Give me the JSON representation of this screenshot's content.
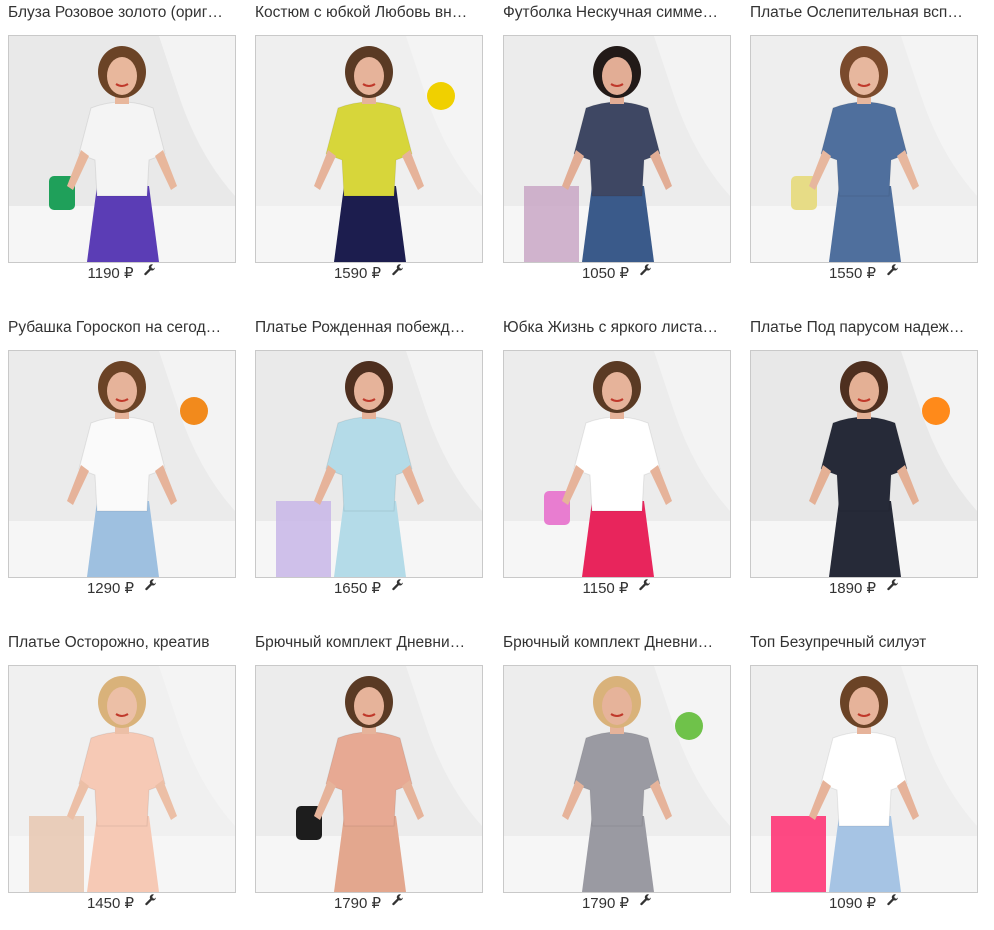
{
  "products": [
    {
      "title": "Блуза Розовое золото (ориг…",
      "price": "1190 ₽",
      "icon": "wrench-icon",
      "bg": "#e9e9e9",
      "top": "#f4f4f4",
      "bottom": "#5b3db5",
      "acc": "#1fa05a",
      "skin": "#e8b79c",
      "hair": "#6b4326"
    },
    {
      "title": "Костюм с юбкой Любовь вн…",
      "price": "1590 ₽",
      "icon": "wrench-icon",
      "bg": "#efefef",
      "top": "#d7d63a",
      "bottom": "#1c1d4e",
      "acc": "#f0d000",
      "skin": "#e6b39a",
      "hair": "#5a3a24"
    },
    {
      "title": "Футболка Нескучная симме…",
      "price": "1050 ₽",
      "icon": "wrench-icon",
      "bg": "#ececec",
      "top": "#3e4763",
      "bottom": "#3a5a8a",
      "acc": "#c9a7c5",
      "skin": "#e2ad95",
      "hair": "#221a18"
    },
    {
      "title": "Платье Ослепительная всп…",
      "price": "1550 ₽",
      "icon": "wrench-icon",
      "bg": "#eeeeee",
      "top": "#4f6f9d",
      "bottom": "#4f6f9d",
      "acc": "#e7dc86",
      "skin": "#e7b79e",
      "hair": "#7a4a2c"
    },
    {
      "title": "Рубашка Гороскоп на сегод…",
      "price": "1290 ₽",
      "icon": "wrench-icon",
      "bg": "#ebebeb",
      "top": "#fafafa",
      "bottom": "#9ec0e0",
      "acc": "#f28a1c",
      "skin": "#e6b39a",
      "hair": "#6b4326"
    },
    {
      "title": "Платье Рожденная побежд…",
      "price": "1650 ₽",
      "icon": "wrench-icon",
      "bg": "#eaeaea",
      "top": "#b4dbe8",
      "bottom": "#b4dbe8",
      "acc": "#c8b6e8",
      "skin": "#e6b39a",
      "hair": "#4e2f1f"
    },
    {
      "title": "Юбка Жизнь с яркого листа…",
      "price": "1150 ₽",
      "icon": "wrench-icon",
      "bg": "#ececec",
      "top": "#ffffff",
      "bottom": "#e8255c",
      "acc": "#e87dd0",
      "skin": "#e6b39a",
      "hair": "#5a3a24"
    },
    {
      "title": "Платье Под парусом надеж…",
      "price": "1890 ₽",
      "icon": "wrench-icon",
      "bg": "#e8e8e8",
      "top": "#262a38",
      "bottom": "#262a38",
      "acc": "#ff8a1a",
      "skin": "#e4b095",
      "hair": "#4e2f1f"
    },
    {
      "title": "Платье Осторожно, креатив",
      "price": "1450 ₽",
      "icon": "wrench-icon",
      "bg": "#f0f0f0",
      "top": "#f6c9b5",
      "bottom": "#f6c9b5",
      "acc": "#e7c7b0",
      "skin": "#ecbfa6",
      "hair": "#d9b27a"
    },
    {
      "title": "Брючный комплект Дневни…",
      "price": "1790 ₽",
      "icon": "wrench-icon",
      "bg": "#ececec",
      "top": "#e7a993",
      "bottom": "#e3a78e",
      "acc": "#1d1d1d",
      "skin": "#e6b39a",
      "hair": "#5a3a24"
    },
    {
      "title": "Брючный комплект Дневни…",
      "price": "1790 ₽",
      "icon": "wrench-icon",
      "bg": "#ededed",
      "top": "#9a9aa2",
      "bottom": "#9a9aa2",
      "acc": "#6fc24a",
      "skin": "#e6b39a",
      "hair": "#d9b27a"
    },
    {
      "title": "Топ Безупречный силуэт",
      "price": "1090 ₽",
      "icon": "wrench-icon",
      "bg": "#eeeeee",
      "top": "#ffffff",
      "bottom": "#a6c4e4",
      "acc": "#ff2a6e",
      "skin": "#e6b39a",
      "hair": "#6b4326"
    }
  ],
  "currency_wrench_glyph": "🔧"
}
